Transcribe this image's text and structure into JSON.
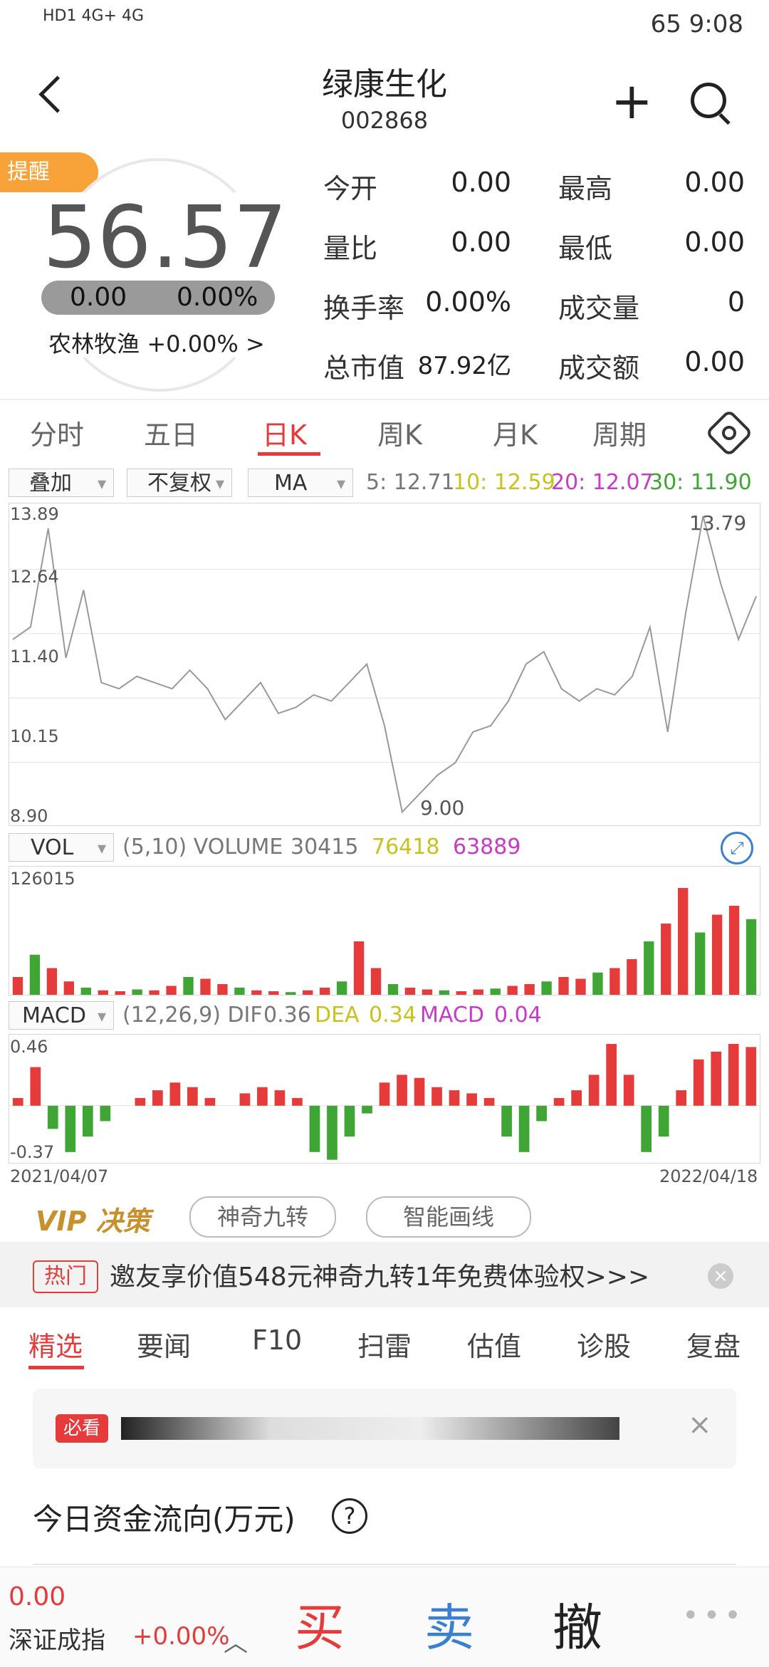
{
  "status": {
    "left": "HD1 4G+ 4G",
    "right": "65  9:08"
  },
  "header": {
    "title": "绿康生化",
    "code": "002868"
  },
  "remind_label": "提醒",
  "price": {
    "value": "56.57",
    "change": "0.00",
    "change_pct": "0.00%",
    "industry": "农林牧渔 +0.00% >"
  },
  "quote": [
    {
      "label": "今开",
      "value": "0.00"
    },
    {
      "label": "最高",
      "value": "0.00"
    },
    {
      "label": "量比",
      "value": "0.00"
    },
    {
      "label": "最低",
      "value": "0.00"
    },
    {
      "label": "换手率",
      "value": "0.00%"
    },
    {
      "label": "成交量",
      "value": "0"
    },
    {
      "label": "总市值",
      "value": "87.92亿"
    },
    {
      "label": "成交额",
      "value": "0.00"
    }
  ],
  "ktabs": [
    "分时",
    "五日",
    "日K",
    "周K",
    "月K",
    "周期"
  ],
  "controls": {
    "overlay": "叠加",
    "adjust": "不复权",
    "indicator": "MA",
    "ma5": "5: 12.71",
    "ma10": "10: 12.59",
    "ma20": "20: 12.07",
    "ma30": "30: 11.90"
  },
  "volume_bar": {
    "select": "VOL",
    "params": "(5,10) VOLUME",
    "v1": "30415",
    "v2": "76418",
    "v3": "63889"
  },
  "macd_bar": {
    "select": "MACD",
    "params": "(12,26,9) DIF",
    "dif": "0.36",
    "dea_label": "DEA",
    "dea": "0.34",
    "macd_label": "MACD",
    "macd": "0.04"
  },
  "dates": {
    "start": "2021/04/07",
    "end": "2022/04/18"
  },
  "colors": {
    "red": "#e63b3b",
    "green": "#3fa535",
    "ma10": "#c9c21b",
    "ma20": "#c93ac9",
    "price_line": "#999999"
  },
  "chart_data": [
    {
      "type": "line",
      "title": "",
      "yticks": [
        "13.89",
        "12.64",
        "11.40",
        "10.15",
        "8.90"
      ],
      "ylim": [
        8.9,
        13.89
      ],
      "annotations": [
        "13.79",
        "9.00"
      ],
      "series": [
        {
          "values": [
            11.8,
            12.0,
            13.6,
            11.5,
            12.6,
            11.1,
            11.0,
            11.2,
            11.1,
            11.0,
            11.3,
            11.0,
            10.5,
            10.8,
            11.1,
            10.6,
            10.7,
            10.9,
            10.8,
            11.1,
            11.4,
            10.4,
            9.0,
            9.3,
            9.6,
            9.8,
            10.3,
            10.4,
            10.8,
            11.4,
            11.6,
            11.0,
            10.8,
            11.0,
            10.9,
            11.2,
            12.0,
            10.3,
            12.2,
            13.8,
            12.7,
            11.8,
            12.5
          ]
        }
      ]
    },
    {
      "type": "bar",
      "title": "",
      "ymax_label": "126015",
      "values": [
        20,
        45,
        30,
        15,
        8,
        5,
        4,
        6,
        5,
        10,
        20,
        18,
        12,
        8,
        5,
        4,
        3,
        5,
        8,
        15,
        60,
        30,
        12,
        8,
        6,
        5,
        4,
        6,
        7,
        10,
        12,
        15,
        20,
        18,
        25,
        30,
        40,
        60,
        80,
        120,
        70,
        90,
        100,
        85
      ]
    },
    {
      "type": "bar",
      "title": "",
      "yticks": [
        "0.46",
        "-0.37"
      ],
      "values": [
        0.05,
        0.25,
        -0.15,
        -0.3,
        -0.2,
        -0.1,
        0.0,
        0.05,
        0.1,
        0.15,
        0.12,
        0.05,
        0.0,
        0.08,
        0.12,
        0.1,
        0.05,
        -0.3,
        -0.35,
        -0.2,
        -0.05,
        0.15,
        0.2,
        0.18,
        0.12,
        0.1,
        0.08,
        0.05,
        -0.2,
        -0.3,
        -0.1,
        0.05,
        0.1,
        0.2,
        0.4,
        0.2,
        -0.3,
        -0.2,
        0.1,
        0.3,
        0.35,
        0.4,
        0.38
      ]
    }
  ],
  "vip": {
    "label": "VIP 决策",
    "chip1": "神奇九转",
    "chip2": "智能画线"
  },
  "banner": {
    "hot": "热门",
    "text": "邀友享价值548元神奇九转1年免费体验权>>>"
  },
  "news_tabs": [
    "精选",
    "要闻",
    "F10",
    "扫雷",
    "估值",
    "诊股",
    "复盘"
  ],
  "must": "必看",
  "flow_title": "今日资金流向(万元)",
  "bottom": {
    "index_value": "0.00",
    "index_name": "深证成指",
    "index_pct": "+0.00%",
    "buy": "买",
    "sell": "卖",
    "undo": "撤",
    "more": "•••"
  }
}
